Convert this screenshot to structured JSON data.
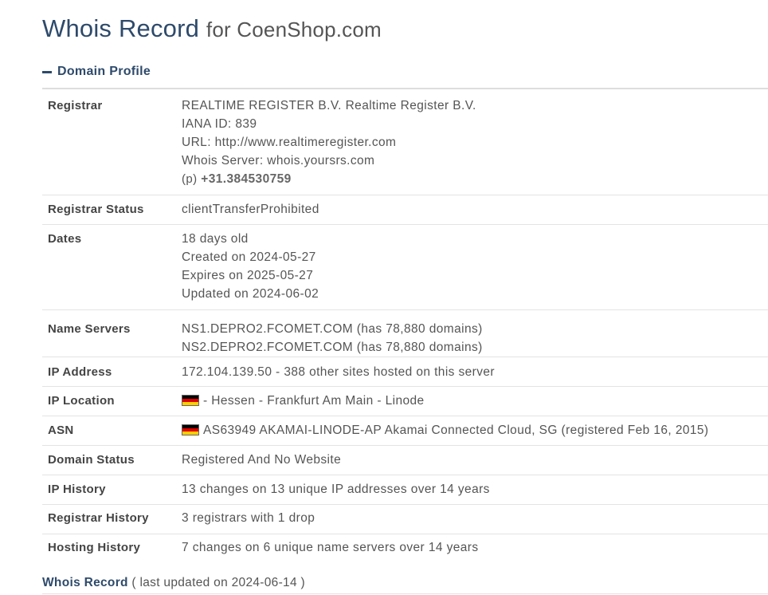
{
  "title": {
    "main": "Whois Record",
    "suffix": "for CoenShop.com"
  },
  "section": {
    "label": "Domain Profile"
  },
  "flag_colors": {
    "top": "#000000",
    "middle": "#dd0000",
    "bottom": "#ffce00"
  },
  "rows": [
    {
      "label": "Registrar",
      "lines": [
        "REALTIME REGISTER B.V. Realtime Register B.V.",
        "IANA ID: 839",
        "URL: http://www.realtimeregister.com",
        "Whois Server: whois.yoursrs.com"
      ],
      "phone_prefix": "(p)",
      "phone": "+31.384530759"
    },
    {
      "label": "Registrar Status",
      "lines": [
        "clientTransferProhibited"
      ]
    },
    {
      "label": "Dates",
      "lines": [
        "18 days old",
        "Created on 2024-05-27",
        "Expires on 2025-05-27",
        "Updated on 2024-06-02"
      ]
    },
    {
      "label": "Name Servers",
      "lines": [
        "NS1.DEPRO2.FCOMET.COM (has 78,880 domains)",
        "NS2.DEPRO2.FCOMET.COM (has 78,880 domains)"
      ]
    },
    {
      "label": "IP Address",
      "lines": [
        "172.104.139.50 - 388 other sites hosted on this server"
      ]
    },
    {
      "label": "IP Location",
      "flag_icon": "germany-flag-icon",
      "lines": [
        "- Hessen - Frankfurt Am Main - Linode"
      ]
    },
    {
      "label": "ASN",
      "flag_icon": "germany-flag-icon",
      "lines": [
        "AS63949 AKAMAI-LINODE-AP Akamai Connected Cloud, SG (registered Feb 16, 2015)"
      ]
    },
    {
      "label": "Domain Status",
      "lines": [
        "Registered And No Website"
      ]
    },
    {
      "label": "IP History",
      "lines": [
        "13 changes on 13 unique IP addresses over 14 years"
      ]
    },
    {
      "label": "Registrar History",
      "lines": [
        "3 registrars with 1 drop"
      ]
    },
    {
      "label": "Hosting History",
      "lines": [
        "7 changes on 6 unique name servers over 14 years"
      ]
    }
  ],
  "footer": {
    "link": "Whois Record",
    "note": "( last updated on 2024-06-14 )"
  }
}
